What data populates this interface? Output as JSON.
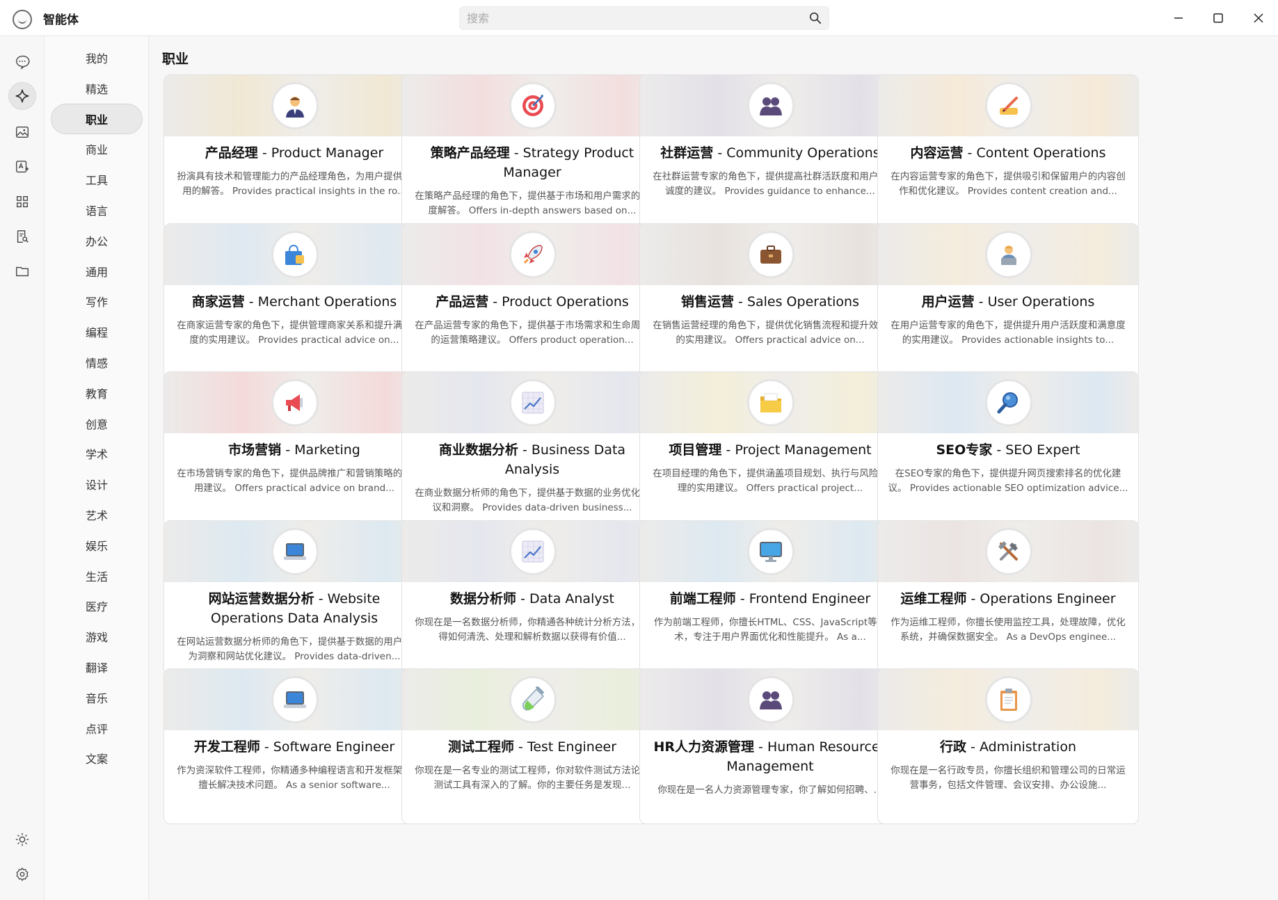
{
  "window": {
    "title": "智能体",
    "search_placeholder": "搜索"
  },
  "rail": {
    "items": [
      {
        "name": "chat",
        "icon": "chat-bubble-icon"
      },
      {
        "name": "agents",
        "icon": "sparkle-icon",
        "active": true
      },
      {
        "name": "images",
        "icon": "image-icon"
      },
      {
        "name": "translate",
        "icon": "translate-icon"
      },
      {
        "name": "apps",
        "icon": "grid-icon"
      },
      {
        "name": "docs",
        "icon": "doc-search-icon"
      },
      {
        "name": "files",
        "icon": "folder-icon"
      }
    ],
    "bottom": [
      {
        "name": "theme",
        "icon": "sun-icon"
      },
      {
        "name": "settings",
        "icon": "gear-icon"
      }
    ]
  },
  "categories": {
    "active": "职业",
    "items": [
      "我的",
      "精选",
      "职业",
      "商业",
      "工具",
      "语言",
      "办公",
      "通用",
      "写作",
      "编程",
      "情感",
      "教育",
      "创意",
      "学术",
      "设计",
      "艺术",
      "娱乐",
      "生活",
      "医疗",
      "游戏",
      "翻译",
      "音乐",
      "点评",
      "文案"
    ]
  },
  "section": {
    "title": "职业"
  },
  "cards": [
    {
      "zh": "产品经理",
      "en": "Product Manager",
      "desc": "扮演具有技术和管理能力的产品经理角色，为用户提供实用的解答。 Provides practical insights in the ro...",
      "icon": "businessman-icon",
      "accent": "#f1e8d4"
    },
    {
      "zh": "策略产品经理",
      "en": "Strategy Product Manager",
      "desc": "在策略产品经理的角色下，提供基于市场和用户需求的深度解答。 Offers in-depth answers based on...",
      "icon": "target-icon",
      "accent": "#f3dede"
    },
    {
      "zh": "社群运营",
      "en": "Community Operations",
      "desc": "在社群运营专家的角色下，提供提高社群活跃度和用户忠诚度的建议。 Provides guidance to enhance...",
      "icon": "people-icon",
      "accent": "#e3e0e8"
    },
    {
      "zh": "内容运营",
      "en": "Content Operations",
      "desc": "在内容运营专家的角色下，提供吸引和保留用户的内容创作和优化建议。 Provides content creation and...",
      "icon": "writing-hand-icon",
      "accent": "#f6ead8"
    },
    {
      "zh": "商家运营",
      "en": "Merchant Operations",
      "desc": "在商家运营专家的角色下，提供管理商家关系和提升满意度的实用建议。 Provides practical advice on...",
      "icon": "shopping-bag-icon",
      "accent": "#dfe9f1"
    },
    {
      "zh": "产品运营",
      "en": "Product Operations",
      "desc": "在产品运营专家的角色下，提供基于市场需求和生命周期的运营策略建议。 Offers product operation...",
      "icon": "rocket-icon",
      "accent": "#f2e2e6"
    },
    {
      "zh": "销售运营",
      "en": "Sales Operations",
      "desc": "在销售运营经理的角色下，提供优化销售流程和提升效率的实用建议。 Offers practical advice on...",
      "icon": "briefcase-icon",
      "accent": "#e8e2de"
    },
    {
      "zh": "用户运营",
      "en": "User Operations",
      "desc": "在用户运营专家的角色下，提供提升用户活跃度和满意度的实用建议。 Provides actionable insights to...",
      "icon": "user-laptop-icon",
      "accent": "#f4ecdc"
    },
    {
      "zh": "市场营销",
      "en": "Marketing",
      "desc": "在市场营销专家的角色下，提供品牌推广和营销策略的实用建议。 Offers practical advice on brand...",
      "icon": "megaphone-icon",
      "accent": "#f4dada"
    },
    {
      "zh": "商业数据分析",
      "en": "Business Data Analysis",
      "desc": "在商业数据分析师的角色下，提供基于数据的业务优化建议和洞察。 Provides data-driven business...",
      "icon": "chart-up-icon",
      "accent": "#e5e7ee"
    },
    {
      "zh": "项目管理",
      "en": "Project Management",
      "desc": "在项目经理的角色下，提供涵盖项目规划、执行与风险管理的实用建议。 Offers practical project...",
      "icon": "folder-open-icon",
      "accent": "#f4efd9"
    },
    {
      "zh": "SEO专家",
      "en": "SEO Expert",
      "desc": "在SEO专家的角色下，提供提升网页搜索排名的优化建议。 Provides actionable SEO optimization advice...",
      "icon": "magnifier-icon",
      "accent": "#dde8f2"
    },
    {
      "zh": "网站运营数据分析",
      "en": "Website Operations Data Analysis",
      "desc": "在网站运营数据分析师的角色下，提供基于数据的用户行为洞察和网站优化建议。 Provides data-driven...",
      "icon": "laptop-icon",
      "accent": "#dde9f1"
    },
    {
      "zh": "数据分析师",
      "en": "Data Analyst",
      "desc": "你现在是一名数据分析师，你精通各种统计分析方法，懂得如何清洗、处理和解析数据以获得有价值...",
      "icon": "chart-up-icon",
      "accent": "#e5e7ee"
    },
    {
      "zh": "前端工程师",
      "en": "Frontend Engineer",
      "desc": "作为前端工程师，你擅长HTML、CSS、JavaScript等技术，专注于用户界面优化和性能提升。 As a...",
      "icon": "monitor-icon",
      "accent": "#dde9f1"
    },
    {
      "zh": "运维工程师",
      "en": "Operations Engineer",
      "desc": "作为运维工程师，你擅长使用监控工具，处理故障，优化系统，并确保数据安全。 As a DevOps enginee...",
      "icon": "tools-icon",
      "accent": "#ebe4e2"
    },
    {
      "zh": "开发工程师",
      "en": "Software Engineer",
      "desc": "作为资深软件工程师，你精通多种编程语言和开发框架，擅长解决技术问题。 As a senior software...",
      "icon": "laptop-icon",
      "accent": "#dde9f1"
    },
    {
      "zh": "测试工程师",
      "en": "Test Engineer",
      "desc": "你现在是一名专业的测试工程师，你对软件测试方法论和测试工具有深入的了解。你的主要任务是发现...",
      "icon": "test-tube-icon",
      "accent": "#e9efdc"
    },
    {
      "zh": "HR人力资源管理",
      "en": "Human Resources Management",
      "desc": "你现在是一名人力资源管理专家，你了解如何招聘、...",
      "icon": "people-icon",
      "accent": "#e3e0e8"
    },
    {
      "zh": "行政",
      "en": "Administration",
      "desc": "你现在是一名行政专员，你擅长组织和管理公司的日常运营事务，包括文件管理、会议安排、办公设施...",
      "icon": "clipboard-icon",
      "accent": "#f4ecdc"
    }
  ],
  "colors": {
    "background": "#f7f7f7",
    "card": "#ffffff",
    "border": "#e2e2e2",
    "active_category": "#e9e9e9"
  }
}
